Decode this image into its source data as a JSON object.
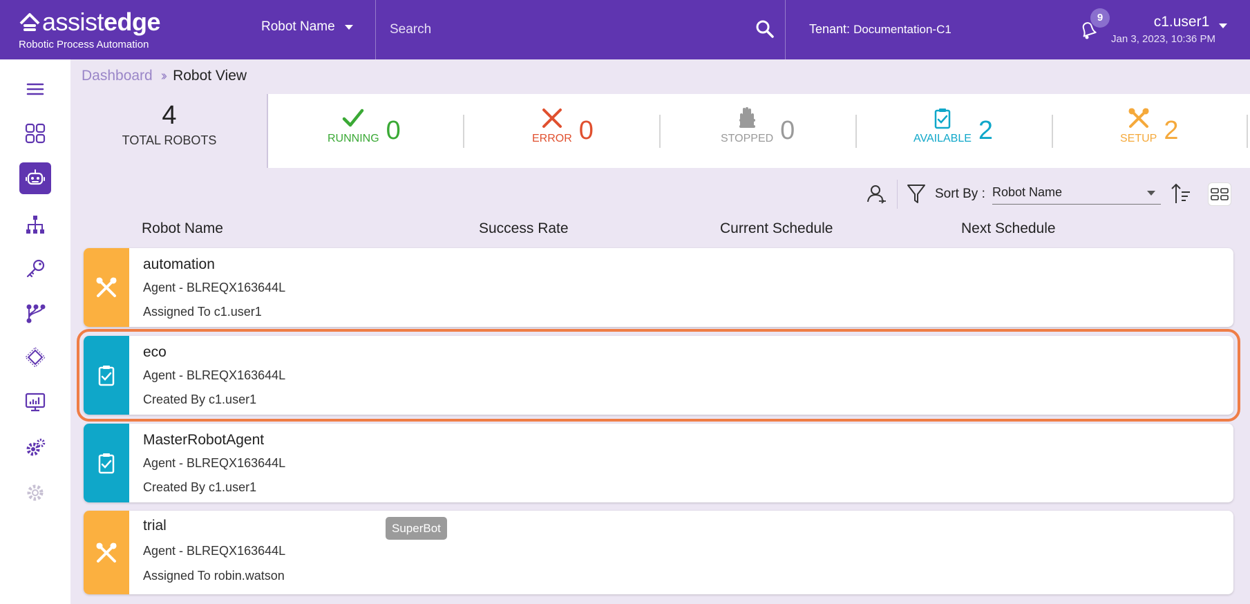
{
  "brand": {
    "name_thin": "assist",
    "name_bold": "edge",
    "subtitle": "Robotic Process Automation"
  },
  "header": {
    "search_scope": "Robot Name",
    "search_placeholder": "Search",
    "tenant_label": "Tenant:",
    "tenant_value": "Documentation-C1",
    "notification_count": "9",
    "user_name": "c1.user1",
    "datetime": "Jan 3, 2023, 10:36 PM"
  },
  "breadcrumb": {
    "parent": "Dashboard",
    "separator": "»",
    "current": "Robot View"
  },
  "stats": {
    "total": {
      "value": "4",
      "label": "TOTAL ROBOTS"
    },
    "running": {
      "label": "RUNNING",
      "value": "0",
      "color": "#3aa935"
    },
    "error": {
      "label": "ERROR",
      "value": "0",
      "color": "#e0502f"
    },
    "stopped": {
      "label": "STOPPED",
      "value": "0",
      "color": "#9a9a9a"
    },
    "available": {
      "label": "AVAILABLE",
      "value": "2",
      "color": "#0fa7c9"
    },
    "setup": {
      "label": "SETUP",
      "value": "2",
      "color": "#f5a93b"
    }
  },
  "toolbar": {
    "sort_label": "Sort By :",
    "sort_value": "Robot Name"
  },
  "columns": {
    "name": "Robot Name",
    "success": "Success Rate",
    "current": "Current Schedule",
    "next": "Next Schedule"
  },
  "robots": [
    {
      "name": "automation",
      "agent": "Agent - BLREQX163644L",
      "owner": "Assigned To c1.user1",
      "status": "setup"
    },
    {
      "name": "eco",
      "agent": "Agent - BLREQX163644L",
      "owner": "Created By c1.user1",
      "status": "available"
    },
    {
      "name": "MasterRobotAgent",
      "agent": "Agent - BLREQX163644L",
      "owner": "Created By c1.user1",
      "status": "available"
    },
    {
      "name": "trial",
      "agent": "Agent - BLREQX163644L",
      "owner": "Assigned To robin.watson",
      "status": "setup",
      "badge": "SuperBot"
    }
  ]
}
